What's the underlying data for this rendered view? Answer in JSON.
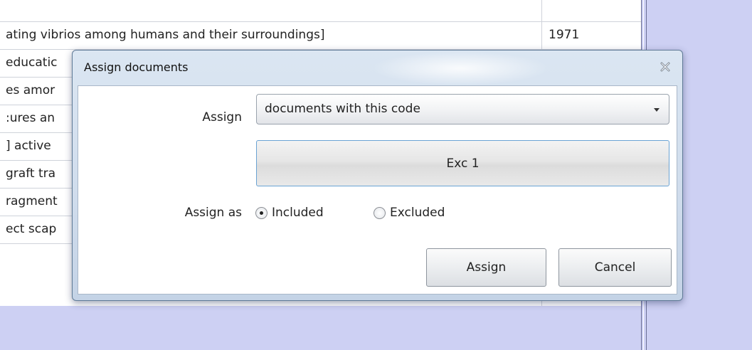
{
  "grid": {
    "rows": [
      {
        "title": "ating vibrios among humans and their surroundings]",
        "year": "1971"
      },
      {
        "title": "educatic",
        "year": ""
      },
      {
        "title": "es amor",
        "year": ""
      },
      {
        "title": ":ures an",
        "year": ""
      },
      {
        "title": "] active",
        "year": ""
      },
      {
        "title": "graft tra",
        "year": ""
      },
      {
        "title": "ragment",
        "year": ""
      },
      {
        "title": "ect scap",
        "year": ""
      }
    ]
  },
  "dialog": {
    "title": "Assign documents",
    "close_icon": "close-icon",
    "assign_label": "Assign",
    "assign_select_value": "documents with this code",
    "code_select_value": "Exc 1",
    "assign_as_label": "Assign as",
    "radio_included": "Included",
    "radio_excluded": "Excluded",
    "selected_option": "Included",
    "assign_button": "Assign",
    "cancel_button": "Cancel"
  },
  "colors": {
    "page_background": "#cdd0f3",
    "dialog_frame": "#cfdcec",
    "focus_border": "#6aa3d4"
  }
}
